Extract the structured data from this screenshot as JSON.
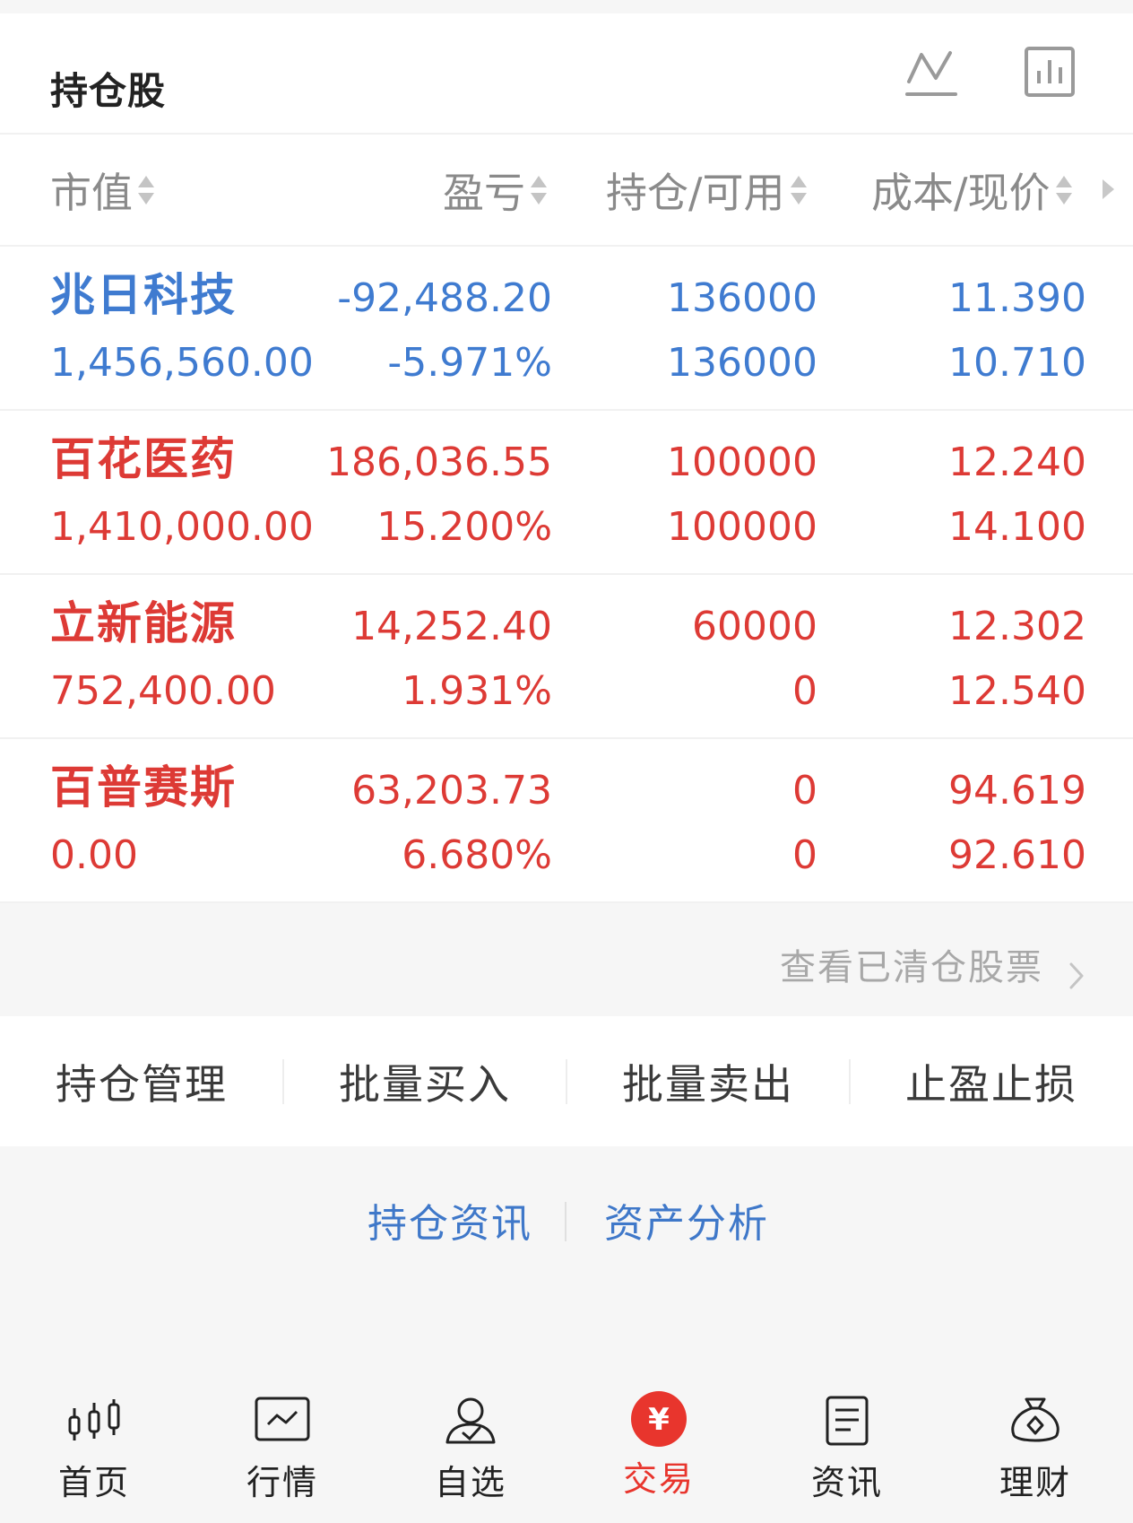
{
  "header": {
    "title": "持仓股",
    "icons": [
      "line-chart-icon",
      "bar-chart-icon"
    ]
  },
  "columns": {
    "market_value": "市值",
    "profit_loss": "盈亏",
    "holding_available": "持仓/可用",
    "cost_price": "成本/现价"
  },
  "stocks": [
    {
      "name": "兆日科技",
      "market_value": "1,456,560.00",
      "profit_loss": "-92,488.20",
      "profit_loss_pct": "-5.971%",
      "holding": "136000",
      "available": "136000",
      "cost": "11.390",
      "price": "10.710",
      "color": "#3f7bd0"
    },
    {
      "name": "百花医药",
      "market_value": "1,410,000.00",
      "profit_loss": "186,036.55",
      "profit_loss_pct": "15.200%",
      "holding": "100000",
      "available": "100000",
      "cost": "12.240",
      "price": "14.100",
      "color": "#dd3a35"
    },
    {
      "name": "立新能源",
      "market_value": "752,400.00",
      "profit_loss": "14,252.40",
      "profit_loss_pct": "1.931%",
      "holding": "60000",
      "available": "0",
      "cost": "12.302",
      "price": "12.540",
      "color": "#dd3a35"
    },
    {
      "name": "百普赛斯",
      "market_value": "0.00",
      "profit_loss": "63,203.73",
      "profit_loss_pct": "6.680%",
      "holding": "0",
      "available": "0",
      "cost": "94.619",
      "price": "92.610",
      "color": "#dd3a35"
    }
  ],
  "cleared_link": "查看已清仓股票",
  "actions": [
    "持仓管理",
    "批量买入",
    "批量卖出",
    "止盈止损"
  ],
  "links": [
    "持仓资讯",
    "资产分析"
  ],
  "nav": [
    {
      "label": "首页",
      "icon": "candlestick-icon",
      "active": false
    },
    {
      "label": "行情",
      "icon": "market-chart-icon",
      "active": false
    },
    {
      "label": "自选",
      "icon": "user-check-icon",
      "active": false
    },
    {
      "label": "交易",
      "icon": "yuan-coin-icon",
      "active": true
    },
    {
      "label": "资讯",
      "icon": "document-icon",
      "active": false
    },
    {
      "label": "理财",
      "icon": "money-bag-icon",
      "active": false
    }
  ],
  "colors": {
    "loss_blue": "#3f7bd0",
    "gain_red": "#dd3a35",
    "link_blue": "#3f78c9",
    "active_red": "#e8352d"
  }
}
